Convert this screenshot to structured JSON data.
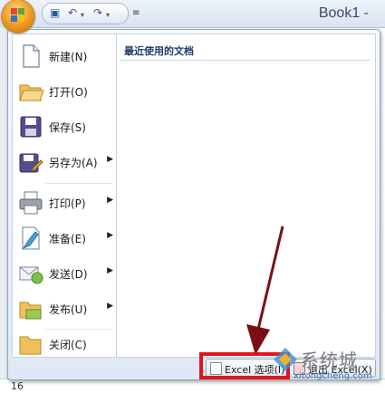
{
  "window": {
    "title": "Book1 -"
  },
  "quick_access": {
    "icons": [
      "save-icon",
      "undo-icon",
      "redo-icon",
      "customize-dropdown-icon"
    ]
  },
  "office_menu": {
    "commands": [
      {
        "label": "新建(N)",
        "icon": "new-document-icon",
        "submenu": false
      },
      {
        "label": "打开(O)",
        "icon": "open-folder-icon",
        "submenu": false
      },
      {
        "label": "保存(S)",
        "icon": "save-disk-icon",
        "submenu": false
      },
      {
        "label": "另存为(A)",
        "icon": "save-as-icon",
        "submenu": true
      },
      {
        "label": "打印(P)",
        "icon": "printer-icon",
        "submenu": true
      },
      {
        "label": "准备(E)",
        "icon": "prepare-icon",
        "submenu": true
      },
      {
        "label": "发送(D)",
        "icon": "send-icon",
        "submenu": true
      },
      {
        "label": "发布(U)",
        "icon": "publish-icon",
        "submenu": true
      },
      {
        "label": "关闭(C)",
        "icon": "close-folder-icon",
        "submenu": false
      }
    ],
    "recent_title": "最近使用的文档",
    "footer": {
      "options_label": "Excel 选项(I)",
      "exit_label": "退出 Excel(X)"
    }
  },
  "sheet": {
    "visible_row_number": "16"
  },
  "watermark": {
    "text": "系统城",
    "url": "xitongcheng.com"
  },
  "colors": {
    "highlight": "#e3141c",
    "arrow": "#7a1016"
  }
}
